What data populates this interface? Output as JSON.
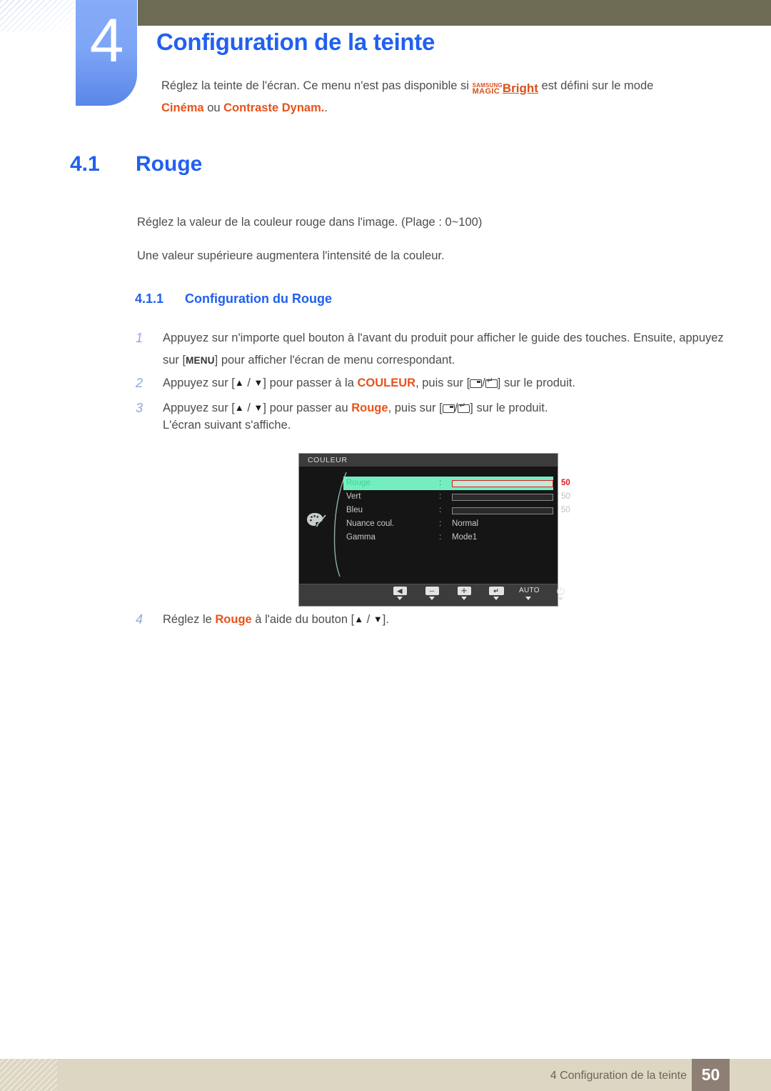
{
  "chapter": {
    "number": "4",
    "title": "Configuration de la teinte",
    "intro_before": "Réglez la teinte de l'écran. Ce menu n'est pas disponible si ",
    "magic_line1": "SAMSUNG",
    "magic_line2": "MAGIC",
    "magic_bright": "Bright",
    "intro_after": " est défini sur le mode ",
    "mode_1": "Cinéma",
    "intro_or": " ou ",
    "mode_2": "Contraste Dynam.",
    "intro_end": "."
  },
  "section": {
    "number": "4.1",
    "title": "Rouge",
    "paragraph_range": "Réglez la valeur de la couleur rouge dans l'image. (Plage : 0~100)",
    "paragraph_intensity": "Une valeur supérieure augmentera l'intensité de la couleur."
  },
  "subsection": {
    "number": "4.1.1",
    "title": "Configuration du Rouge"
  },
  "steps": [
    {
      "number": "1",
      "part1": "Appuyez sur n'importe quel bouton à l'avant du produit pour afficher le guide des touches. Ensuite, appuyez sur [",
      "key": "MENU",
      "part2": "] pour afficher l'écran de menu correspondant."
    },
    {
      "number": "2",
      "part1": "Appuyez sur [",
      "arrow_up": "▲",
      "sep": " / ",
      "arrow_down": "▼",
      "part2": "] pour passer à la ",
      "highlight": "COULEUR",
      "part3": ", puis sur [",
      "part4": "] sur le produit."
    },
    {
      "number": "3",
      "part1": "Appuyez sur [",
      "arrow_up": "▲",
      "sep": " / ",
      "arrow_down": "▼",
      "part2": "] pour passer au ",
      "highlight": "Rouge",
      "part3": ", puis sur [",
      "part4": "] sur le produit."
    },
    {
      "number": "4",
      "part1": "Réglez le ",
      "highlight": "Rouge",
      "part2": " à l'aide du bouton [",
      "arrow_up": "▲",
      "sep": " / ",
      "arrow_down": "▼",
      "part3": "]."
    }
  ],
  "note": "L'écran suivant s'affiche.",
  "osd": {
    "title": "COULEUR",
    "rows": [
      {
        "label": "Rouge",
        "colon": ":",
        "type": "slider",
        "value": "50",
        "fill_percent": 50,
        "active": true
      },
      {
        "label": "Vert",
        "colon": ":",
        "type": "slider",
        "value": "50",
        "fill_percent": 50,
        "active": false
      },
      {
        "label": "Bleu",
        "colon": ":",
        "type": "slider",
        "value": "50",
        "fill_percent": 50,
        "active": false
      },
      {
        "label": "Nuance coul.",
        "colon": ":",
        "type": "text",
        "value": "Normal",
        "active": false
      },
      {
        "label": "Gamma",
        "colon": ":",
        "type": "text",
        "value": "Mode1",
        "active": false
      }
    ],
    "buttons": [
      {
        "kind": "glyph",
        "glyph": "◀",
        "name": "back-button"
      },
      {
        "kind": "glyph",
        "glyph": "─",
        "name": "minus-button"
      },
      {
        "kind": "glyph",
        "glyph": "＋",
        "name": "plus-button"
      },
      {
        "kind": "glyph",
        "glyph": "↵",
        "name": "enter-button"
      },
      {
        "kind": "label",
        "glyph": "AUTO",
        "name": "auto-button"
      },
      {
        "kind": "power",
        "glyph": "⏻",
        "name": "power-button"
      }
    ]
  },
  "footer": {
    "text": "4 Configuration de la teinte",
    "page": "50"
  },
  "colors": {
    "heading_blue": "#2160f0",
    "accent_orange": "#e8521a",
    "olive": "#6e6b55",
    "osd_highlight": "#74eec0",
    "osd_red": "#fd0000",
    "footer_bg": "#ddd6c2",
    "footer_page_bg": "#8e7f75"
  }
}
